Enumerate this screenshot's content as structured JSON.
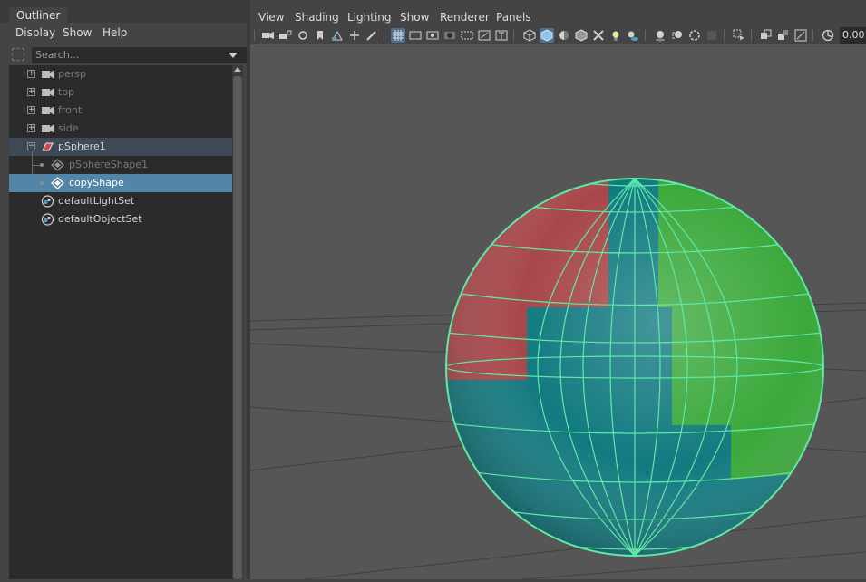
{
  "outliner": {
    "tab_label": "Outliner",
    "menu": [
      "Display",
      "Show",
      "Help"
    ],
    "search_placeholder": "Search...",
    "items": [
      {
        "label": "persp",
        "type": "camera",
        "expander": "+"
      },
      {
        "label": "top",
        "type": "camera",
        "expander": "+"
      },
      {
        "label": "front",
        "type": "camera",
        "expander": "+"
      },
      {
        "label": "side",
        "type": "camera",
        "expander": "+"
      },
      {
        "label": "pSphere1",
        "type": "transform",
        "expander": "−"
      },
      {
        "label": "pSphereShape1",
        "type": "mesh-shape"
      },
      {
        "label": "copyShape",
        "type": "mesh-shape"
      },
      {
        "label": "defaultLightSet",
        "type": "set"
      },
      {
        "label": "defaultObjectSet",
        "type": "set"
      }
    ]
  },
  "viewport": {
    "menu": [
      "View",
      "Shading",
      "Lighting",
      "Show",
      "Renderer",
      "Panels"
    ],
    "toolbar_value": "0.00",
    "wireframe_color": "#5fe8a8",
    "face_colors": {
      "red": "#a8474a",
      "teal": "#127a80",
      "green": "#3aa83a"
    },
    "icons": [
      "camera-icon",
      "camera-lock-icon",
      "camera-attr-icon",
      "bookmark-icon",
      "image-plane-icon",
      "2d-pan-icon",
      "grease-pencil-icon",
      "grid-icon",
      "film-gate-icon",
      "resolution-gate-icon",
      "gate-mask-icon",
      "field-chart-icon",
      "safe-action-icon",
      "safe-title-icon",
      "wireframe-icon",
      "smooth-shade-icon",
      "default-material-icon",
      "wireframe-on-shaded-icon",
      "xray-icon",
      "lights-icon",
      "shadows-icon",
      "ambient-occlusion-icon",
      "motion-blur-icon",
      "antialias-icon",
      "depth-of-field-icon",
      "isolate-select-icon",
      "xray-joints-icon",
      "xray-active-icon",
      "backface-icon",
      "texture-icon",
      "exposure-icon"
    ]
  }
}
